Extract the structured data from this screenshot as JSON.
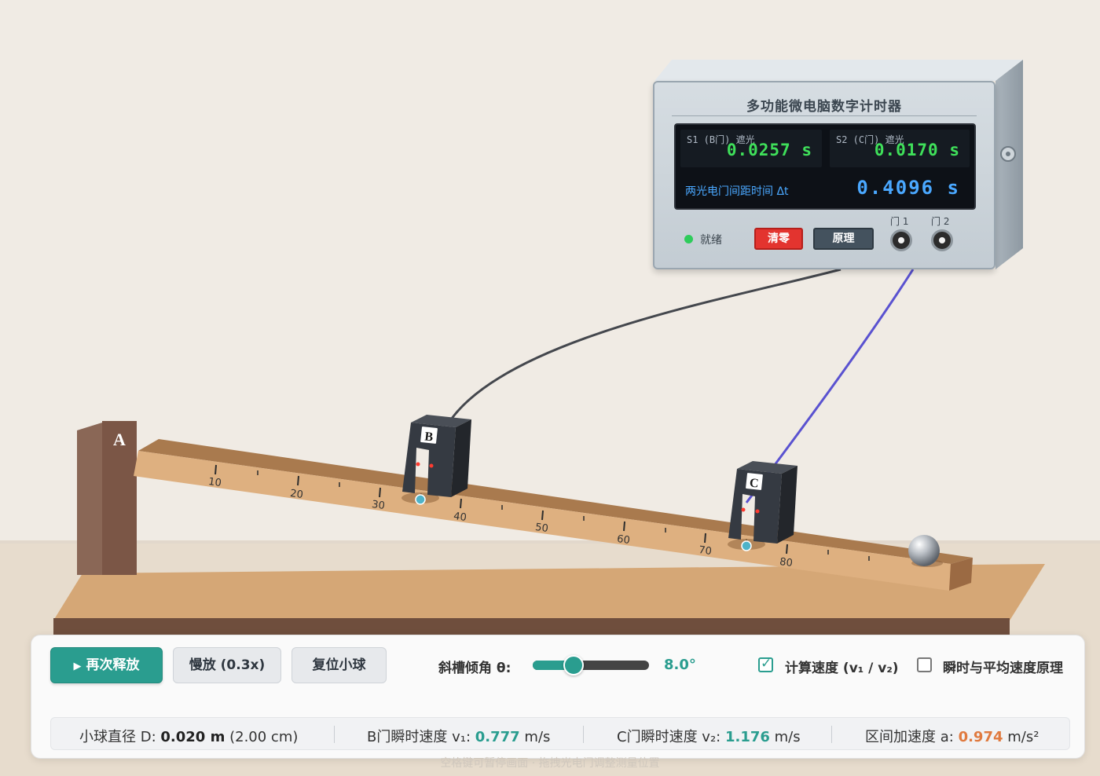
{
  "timer": {
    "title": "多功能微电脑数字计时器",
    "s1_label": "S1 (B门) 遮光",
    "s1_value": "0.0257 s",
    "s2_label": "S2 (C门) 遮光",
    "s2_value": "0.0170 s",
    "dt_label": "两光电门间距时间 Δt",
    "dt_value": "0.4096 s",
    "status": "就绪",
    "clear_label": "清零",
    "principle_label": "原理",
    "jack1_label": "门 1",
    "jack2_label": "门 2"
  },
  "scene": {
    "stop_label": "A",
    "gate_b_label": "B",
    "gate_c_label": "C",
    "ruler_ticks": [
      "10",
      "20",
      "30",
      "40",
      "50",
      "60",
      "70",
      "80"
    ]
  },
  "controls": {
    "release_label": "再次释放",
    "slow_label": "慢放 (0.3x)",
    "reset_label": "复位小球",
    "angle_label": "斜槽倾角 θ:",
    "angle_value": "8.0°",
    "angle_fraction": 0.35,
    "calc_speed_label": "计算速度 (v₁ / v₂)",
    "calc_speed_checked": true,
    "principle_label": "瞬时与平均速度原理",
    "principle_checked": false
  },
  "stats": {
    "diameter_label": "小球直径 D:",
    "diameter_value": "0.020 m",
    "diameter_extra": "(2.00 cm)",
    "v1_label": "B门瞬时速度 v₁:",
    "v1_value": "0.777",
    "v1_unit": "m/s",
    "v2_label": "C门瞬时速度 v₂:",
    "v2_value": "1.176",
    "v2_unit": "m/s",
    "a_label": "区间加速度 a:",
    "a_value": "0.974",
    "a_unit": "m/s²"
  },
  "hint": "空格键可暂停画面 · 拖拽光电门调整测量位置",
  "colors": {
    "accent": "#2a9d8f",
    "danger": "#e3342f",
    "lcd_green": "#3fe05a",
    "lcd_blue": "#4aa8ff",
    "acceleration": "#e07a3f"
  }
}
